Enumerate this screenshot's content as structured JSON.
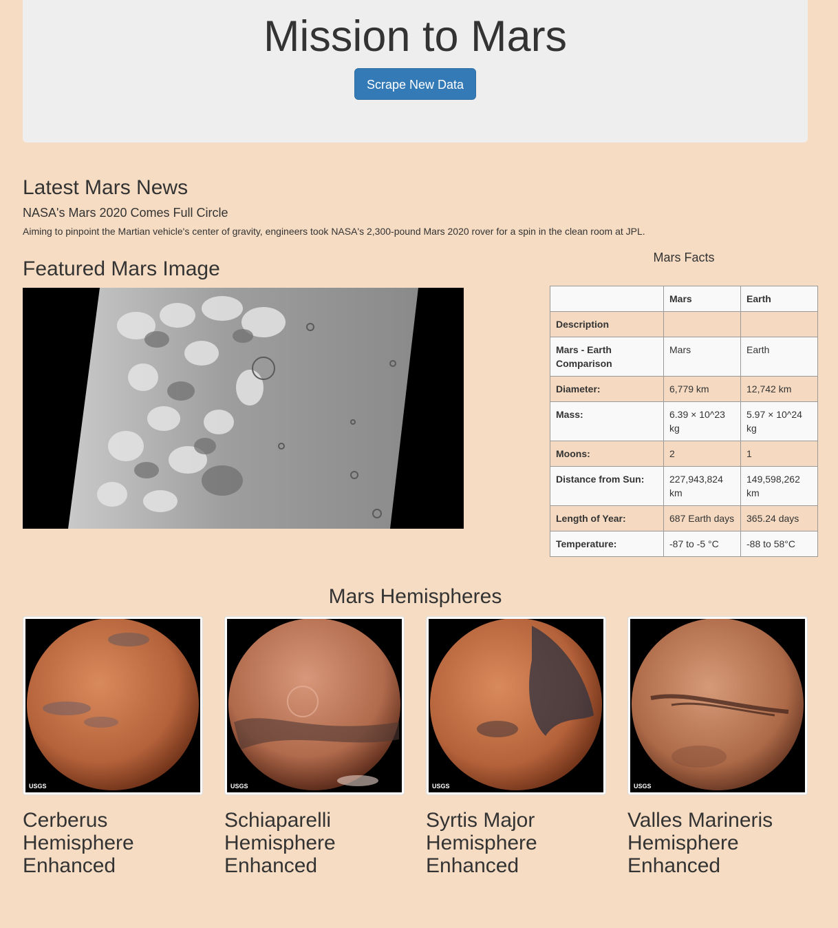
{
  "header": {
    "title": "Mission to Mars",
    "scrape_button": "Scrape New Data"
  },
  "news": {
    "heading": "Latest Mars News",
    "title": "NASA's Mars 2020 Comes Full Circle",
    "teaser": "Aiming to pinpoint the Martian vehicle's center of gravity, engineers took NASA's 2,300-pound Mars 2020 rover for a spin in the clean room at JPL."
  },
  "featured": {
    "heading": "Featured Mars Image"
  },
  "facts": {
    "caption": "Mars Facts",
    "columns": [
      "",
      "Mars",
      "Earth"
    ],
    "rows": [
      {
        "label": "Description",
        "mars": "",
        "earth": ""
      },
      {
        "label": "Mars - Earth Comparison",
        "mars": "Mars",
        "earth": "Earth"
      },
      {
        "label": "Diameter:",
        "mars": "6,779 km",
        "earth": "12,742 km"
      },
      {
        "label": "Mass:",
        "mars": "6.39 × 10^23 kg",
        "earth": "5.97 × 10^24 kg"
      },
      {
        "label": "Moons:",
        "mars": "2",
        "earth": "1"
      },
      {
        "label": "Distance from Sun:",
        "mars": "227,943,824 km",
        "earth": "149,598,262 km"
      },
      {
        "label": "Length of Year:",
        "mars": "687 Earth days",
        "earth": "365.24 days"
      },
      {
        "label": "Temperature:",
        "mars": "-87 to -5 °C",
        "earth": "-88 to 58°C"
      }
    ]
  },
  "hemispheres": {
    "heading": "Mars Hemispheres",
    "items": [
      {
        "title": "Cerberus Hemisphere Enhanced",
        "badge": "USGS"
      },
      {
        "title": "Schiaparelli Hemisphere Enhanced",
        "badge": "USGS"
      },
      {
        "title": "Syrtis Major Hemisphere Enhanced",
        "badge": "USGS"
      },
      {
        "title": "Valles Marineris Hemisphere Enhanced",
        "badge": "USGS"
      }
    ]
  },
  "colors": {
    "page_background": "#f6dcc3",
    "jumbotron": "#eeeeee",
    "button": "#337ab7",
    "mars_surface": "#b8653a"
  }
}
